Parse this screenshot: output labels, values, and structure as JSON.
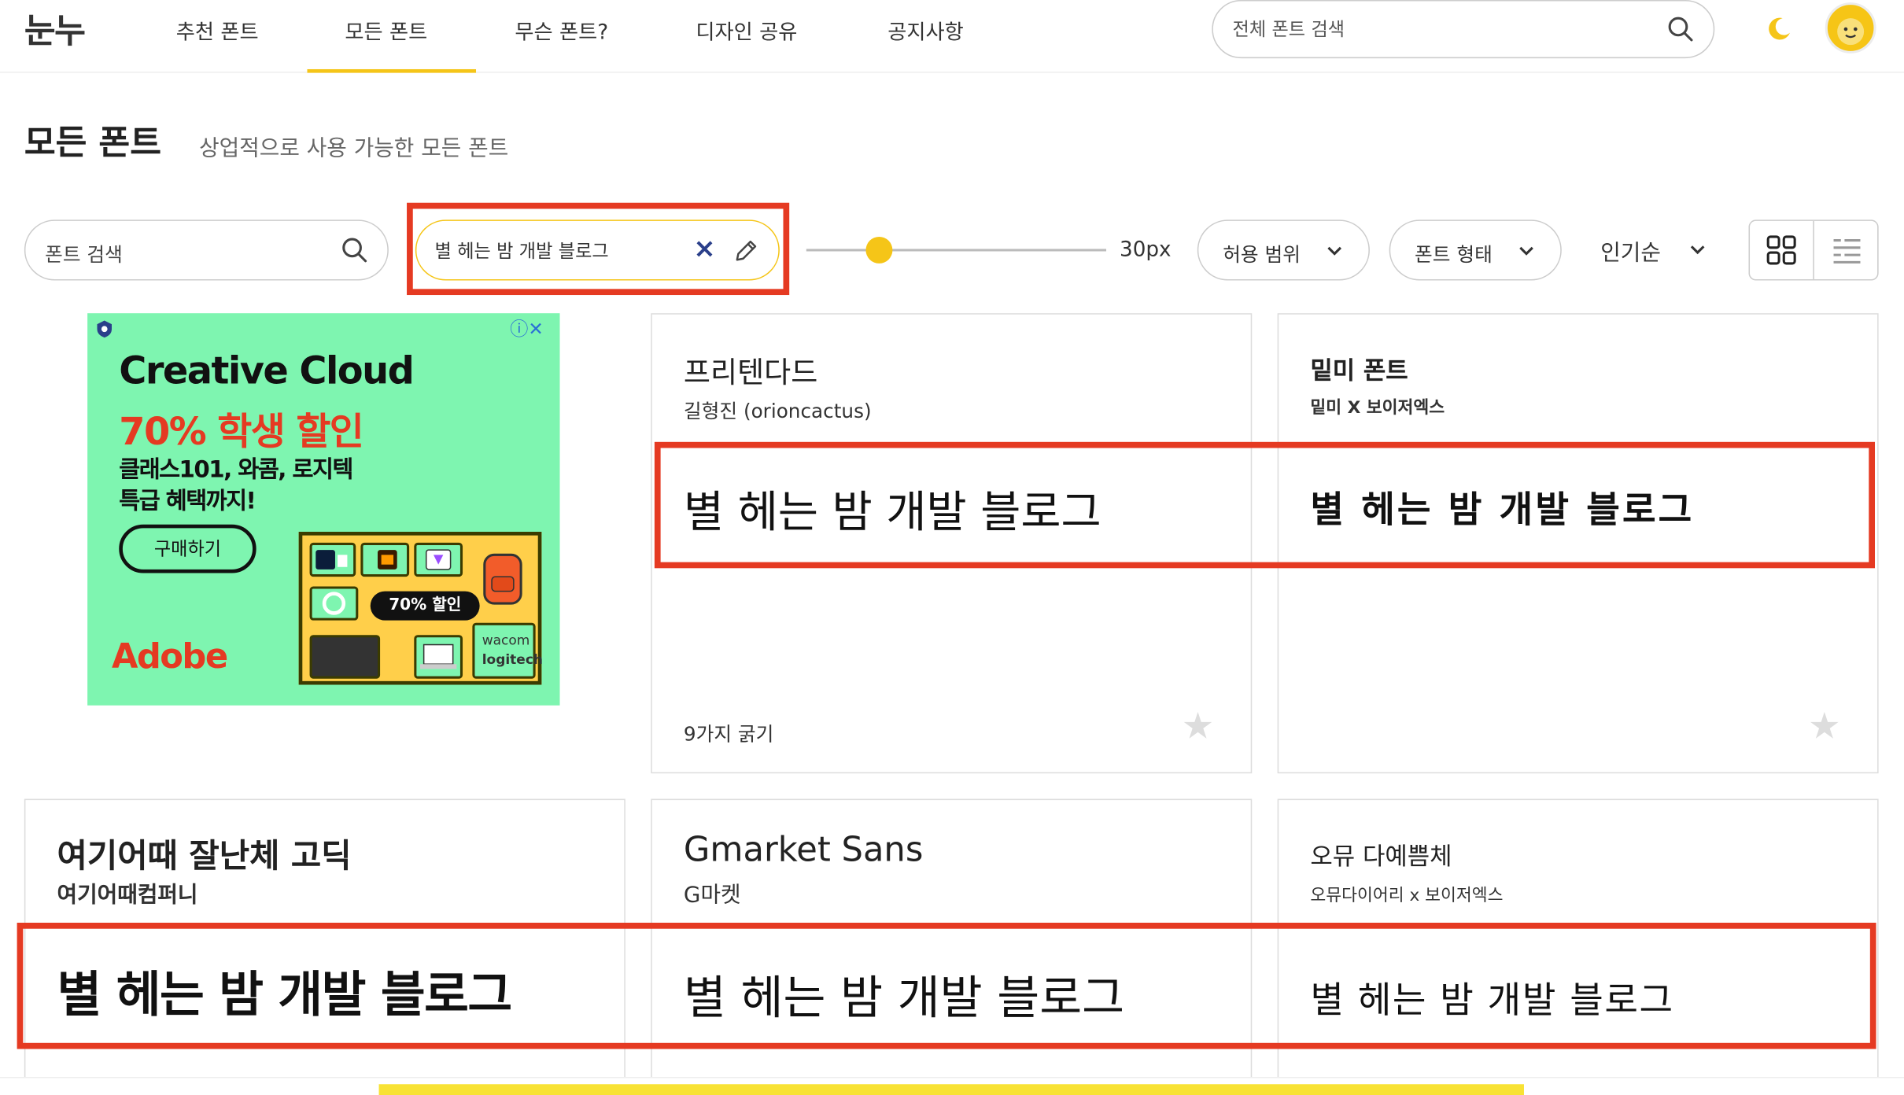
{
  "header": {
    "logo": "눈누",
    "nav": [
      "추천 폰트",
      "모든 폰트",
      "무슨 폰트?",
      "디자인 공유",
      "공지사항"
    ],
    "active_nav": "모든 폰트",
    "search_placeholder": "전체 폰트 검색"
  },
  "page": {
    "title": "모든 폰트",
    "subtitle": "상업적으로 사용 가능한 모든 폰트"
  },
  "filters": {
    "font_search_placeholder": "폰트 검색",
    "preview_text": "별 헤는 밤 개발 블로그",
    "clear_label": "×",
    "size_label": "30px",
    "size_value": 30,
    "license_label": "허용 범위",
    "shape_label": "폰트 형태",
    "sort_label": "인기순"
  },
  "ad": {
    "title": "Creative Cloud",
    "discount": "70% 학생 할인",
    "line1": "클래스101, 와콤, 로지텍",
    "line2": "특급 혜택까지!",
    "button": "구매하기",
    "brand": "Adobe",
    "badge": "70% 할인",
    "partner1": "wacom",
    "partner2": "logitech",
    "close": "ⓘ✕"
  },
  "cards": [
    {
      "name": "프리텐다드",
      "author": "길형진 (orioncactus)",
      "preview": "별 헤는 밤 개발 블로그",
      "weights": "9가지 굵기"
    },
    {
      "name": "밑미 폰트",
      "author": "밑미 X 보이저엑스",
      "preview": "별 헤는 밤 개발 블로그",
      "weights": ""
    },
    {
      "name": "여기어때 잘난체 고딕",
      "author": "여기어때컴퍼니",
      "preview": "별 헤는 밤 개발 블로그"
    },
    {
      "name": "Gmarket Sans",
      "author": "G마켓",
      "preview": "별 헤는 밤 개발 블로그"
    },
    {
      "name": "오뮤 다예쁨체",
      "author": "오뮤다이어리 x 보이저엑스",
      "preview": "별 헤는 밤 개발 블로그"
    }
  ],
  "colors": {
    "accent": "#f5c518",
    "highlight": "#e53a22",
    "ad_bg": "#7ef5b0"
  }
}
